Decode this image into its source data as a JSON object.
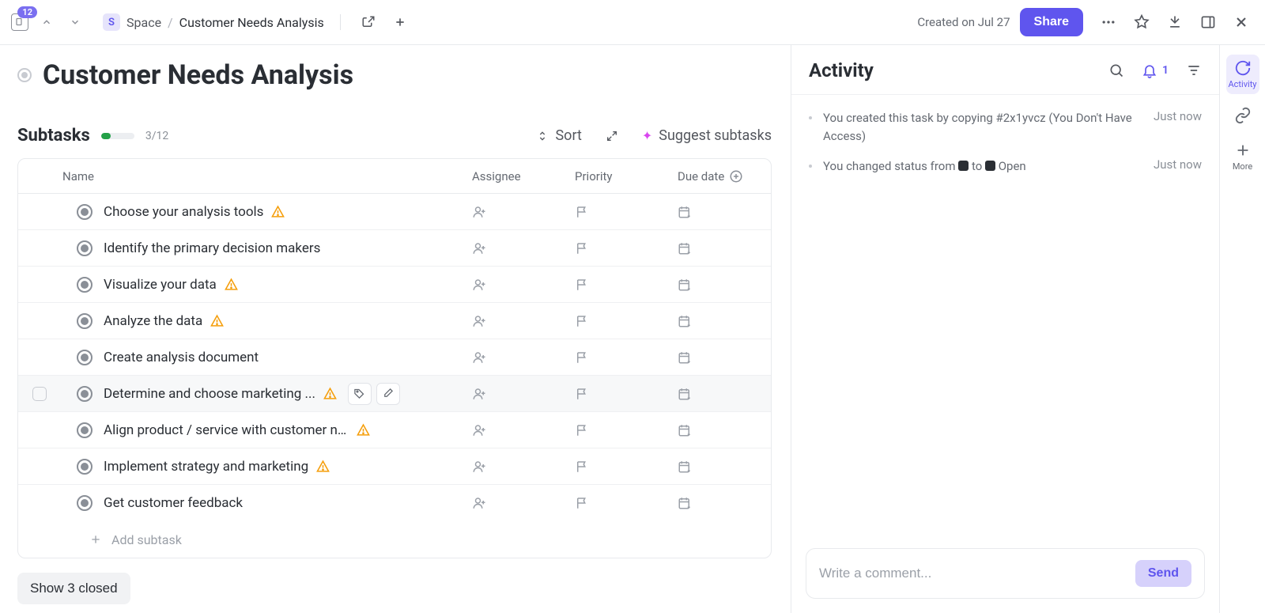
{
  "topbar": {
    "doc_count": "12",
    "space_letter": "S",
    "space_label": "Space",
    "page_name": "Customer Needs Analysis",
    "created_on": "Created on Jul 27",
    "share_label": "Share"
  },
  "title": "Customer Needs Analysis",
  "subtasks": {
    "heading": "Subtasks",
    "progress_text": "3/12",
    "sort_label": "Sort",
    "suggest_label": "Suggest subtasks",
    "columns": {
      "name": "Name",
      "assignee": "Assignee",
      "priority": "Priority",
      "due": "Due date"
    },
    "rows": [
      {
        "name": "Choose your analysis tools",
        "warn": true
      },
      {
        "name": "Identify the primary decision makers",
        "warn": false
      },
      {
        "name": "Visualize your data",
        "warn": true
      },
      {
        "name": "Analyze the data",
        "warn": true
      },
      {
        "name": "Create analysis document",
        "warn": false
      },
      {
        "name": "Determine and choose marketing ...",
        "warn": true,
        "hovered": true
      },
      {
        "name": "Align product / service with customer needs",
        "warn": true
      },
      {
        "name": "Implement strategy and marketing",
        "warn": true
      },
      {
        "name": "Get customer feedback",
        "warn": false
      }
    ],
    "add_label": "Add subtask",
    "show_closed": "Show 3 closed"
  },
  "activity": {
    "title": "Activity",
    "bell_count": "1",
    "items": [
      {
        "text_pre": "You created this task by copying #2x1yvcz (You Don't Have Access)",
        "time": "Just now",
        "status_change": false
      },
      {
        "text_pre": "You changed status from ",
        "text_mid": " to ",
        "text_post": " Open",
        "time": "Just now",
        "status_change": true
      }
    ],
    "comment_placeholder": "Write a comment...",
    "send_label": "Send"
  },
  "rail": {
    "activity_label": "Activity",
    "more_label": "More"
  }
}
